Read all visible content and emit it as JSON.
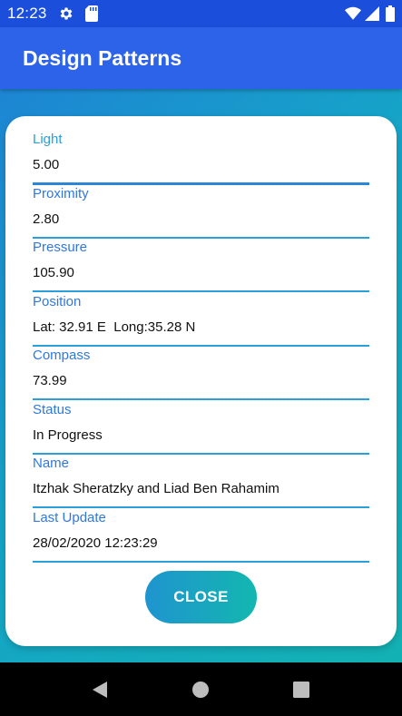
{
  "status_bar": {
    "time": "12:23",
    "icons": [
      "gear-icon",
      "sd-card-icon",
      "wifi-icon",
      "signal-icon",
      "battery-icon"
    ]
  },
  "app_bar": {
    "title": "Design Patterns",
    "color": "#2d63e8"
  },
  "dialog": {
    "fields": [
      {
        "label": "Light",
        "value": "5.00"
      },
      {
        "label": "Proximity",
        "value": "2.80"
      },
      {
        "label": "Pressure",
        "value": "105.90"
      },
      {
        "label": "Position",
        "value": "Lat: 32.91 E  Long:35.28 N"
      },
      {
        "label": "Compass",
        "value": "73.99"
      },
      {
        "label": "Status",
        "value": "In Progress"
      },
      {
        "label": "Name",
        "value": "Itzhak Sheratzky and Liad Ben Rahamim"
      },
      {
        "label": "Last Update",
        "value": "28/02/2020 12:23:29"
      }
    ],
    "close_label": "CLOSE",
    "accent": "#2a9fd9"
  },
  "nav_bar": {
    "icons": [
      "back-icon",
      "home-icon",
      "recents-icon"
    ]
  }
}
